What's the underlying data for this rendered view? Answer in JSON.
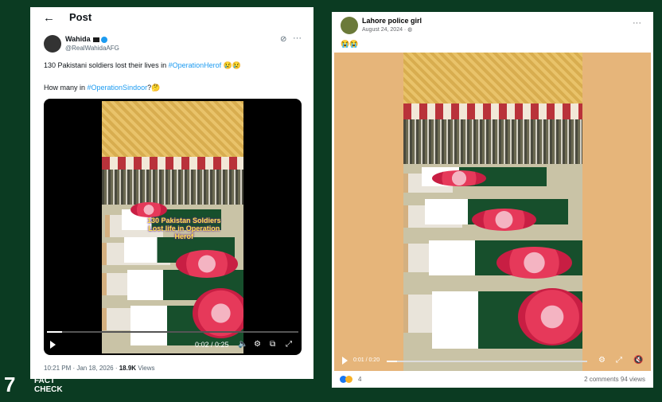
{
  "twitter": {
    "title": "Post",
    "author_name": "Wahida",
    "author_handle": "@RealWahidaAFG",
    "line1_text": "130 Pakistani soldiers lost their lives in ",
    "line1_tag": "#OperationHerof",
    "line1_emoji": " 😢😢",
    "line2_text": "How many in ",
    "line2_tag": "#OperationSindoor",
    "line2_emoji": "?🤔",
    "video_overlay": "130 Pakistan Soldiers Lost life in Operation Herof",
    "video_time": "0:02 / 0:25",
    "video_progress": 0.06,
    "meta_time": "10:21 PM · Jan 18, 2026 · ",
    "meta_views": "18.9K",
    "meta_views_label": " Views"
  },
  "facebook": {
    "author_name": "Lahore police girl",
    "post_date": "August 24, 2024 · ",
    "post_emoji": "😭😭",
    "video_time": "0:01 / 0:20",
    "video_progress": 0.05,
    "reaction_count": "4",
    "comments": "2 comments",
    "views": "94 views"
  },
  "logo": {
    "number": "7",
    "line1": "FACT",
    "line2": "CHECK"
  },
  "colors": {
    "background": "#0b3b22",
    "link": "#1d9bf0"
  }
}
